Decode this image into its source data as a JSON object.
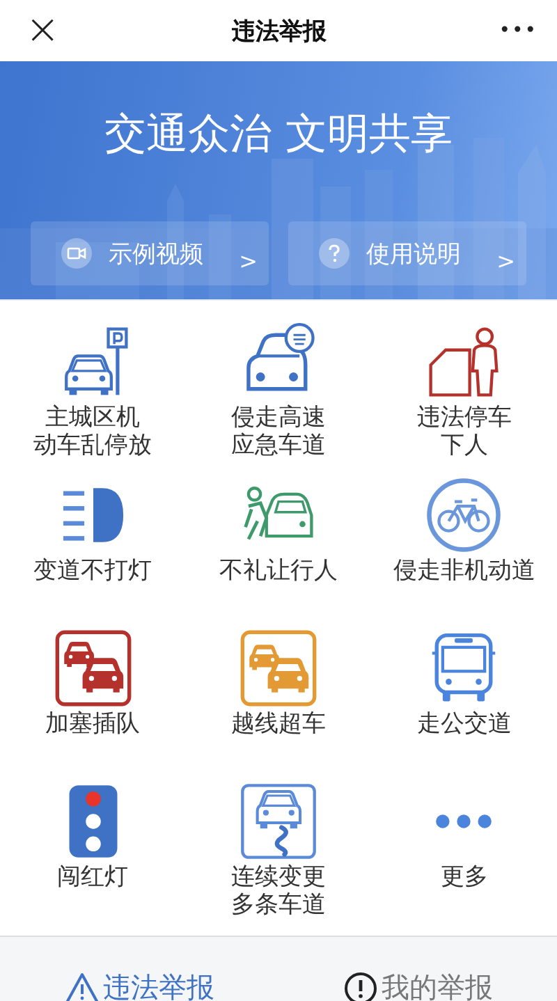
{
  "nav": {
    "close": "×",
    "title": "违法举报",
    "more": "•••"
  },
  "banner": {
    "slogan": "交通众治 文明共享",
    "buttons": [
      {
        "kind": "video",
        "label": "示例视频",
        "chevron": ">"
      },
      {
        "kind": "help",
        "label": "使用说明",
        "chevron": ">"
      }
    ]
  },
  "categories": [
    {
      "kind": "parking",
      "label_lines": [
        "主城区机",
        "动车乱停放"
      ]
    },
    {
      "kind": "emergency",
      "label_lines": [
        "侵走高速",
        "应急车道"
      ]
    },
    {
      "kind": "door",
      "label_lines": [
        "违法停车",
        "下人"
      ]
    },
    {
      "kind": "headlight",
      "label_lines": [
        "变道不打灯"
      ]
    },
    {
      "kind": "pedestrian",
      "label_lines": [
        "不礼让行人"
      ]
    },
    {
      "kind": "bicycle",
      "label_lines": [
        "侵走非机动道"
      ]
    },
    {
      "kind": "cutin",
      "label_lines": [
        "加塞插队"
      ]
    },
    {
      "kind": "overtake",
      "label_lines": [
        "越线超车"
      ]
    },
    {
      "kind": "bus",
      "label_lines": [
        "走公交道"
      ]
    },
    {
      "kind": "redlight",
      "label_lines": [
        "闯红灯"
      ]
    },
    {
      "kind": "lanechange",
      "label_lines": [
        "连续变更",
        "多条车道"
      ]
    },
    {
      "kind": "more",
      "label_lines": [
        "更多"
      ]
    }
  ],
  "tabs": [
    {
      "kind": "warning",
      "label": "违法举报",
      "selected": true
    },
    {
      "kind": "info",
      "label": "我的举报",
      "selected": false
    }
  ]
}
